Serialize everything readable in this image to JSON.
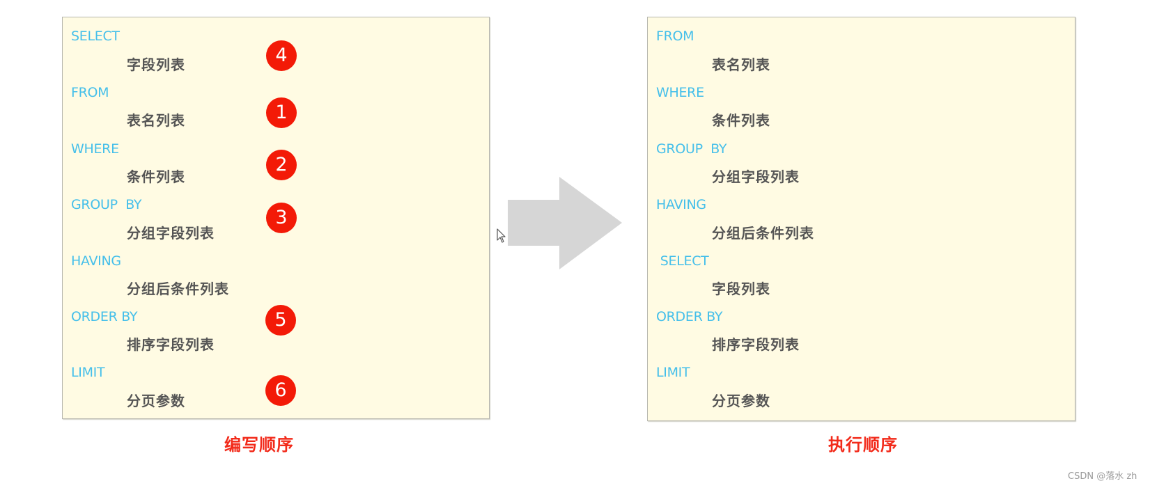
{
  "writing_order": {
    "caption": "编写顺序",
    "lines": [
      {
        "keyword": "SELECT",
        "detail": "字段列表",
        "badge": "4"
      },
      {
        "keyword": "FROM",
        "detail": "表名列表",
        "badge": "1"
      },
      {
        "keyword": "WHERE",
        "detail": "条件列表",
        "badge": "2"
      },
      {
        "keyword": "GROUP  BY",
        "detail": "分组字段列表",
        "badge": "3"
      },
      {
        "keyword": "HAVING",
        "detail": "分组后条件列表",
        "badge": ""
      },
      {
        "keyword": "ORDER BY",
        "detail": "排序字段列表",
        "badge": "5"
      },
      {
        "keyword": "LIMIT",
        "detail": "分页参数",
        "badge": "6"
      }
    ]
  },
  "execution_order": {
    "caption": "执行顺序",
    "lines": [
      {
        "keyword": "FROM",
        "detail": "表名列表"
      },
      {
        "keyword": "WHERE",
        "detail": "条件列表"
      },
      {
        "keyword": "GROUP  BY",
        "detail": "分组字段列表"
      },
      {
        "keyword": "HAVING",
        "detail": "分组后条件列表"
      },
      {
        "keyword": " SELECT",
        "detail": "字段列表"
      },
      {
        "keyword": "ORDER BY",
        "detail": "排序字段列表"
      },
      {
        "keyword": "LIMIT",
        "detail": "分页参数"
      }
    ]
  },
  "arrow": {
    "icon": "right-arrow-icon",
    "color": "#d6d6d6"
  },
  "colors": {
    "keyword": "#45bfea",
    "detail": "#555555",
    "badge": "#f31a07",
    "caption": "#f22a1a",
    "box_bg": "#fffbe3"
  },
  "watermark": "CSDN @落水 zh"
}
